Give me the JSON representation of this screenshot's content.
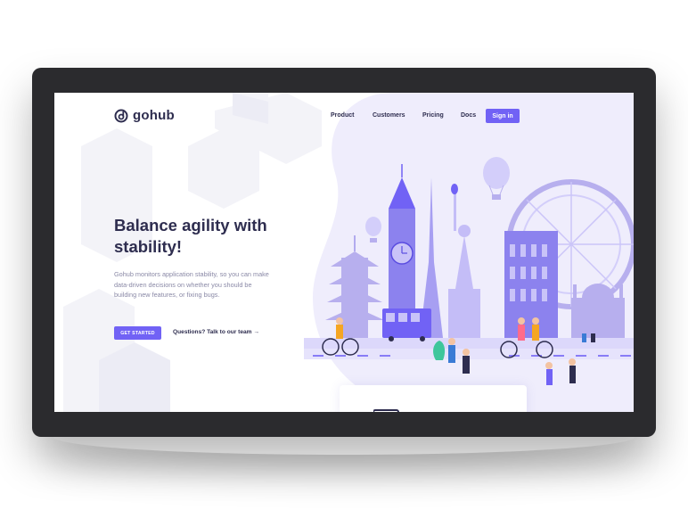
{
  "brand": {
    "name": "gohub",
    "accent": "#7162f5",
    "text": "#2e2d4f"
  },
  "nav": {
    "items": [
      "Product",
      "Customers",
      "Pricing",
      "Docs"
    ],
    "signin": "Sign in"
  },
  "hero": {
    "title_line1": "Balance agility with",
    "title_line2": "stability!",
    "description": "Gohub monitors application stability, so you can make data-driven decisions on whether you should be building new features, or fixing bugs.",
    "cta": "GET STARTED",
    "secondary_link": "Questions? Talk to our team →"
  },
  "icons": {
    "logo": "gohub-logo-icon",
    "illustration": "world-landmarks-illustration"
  }
}
